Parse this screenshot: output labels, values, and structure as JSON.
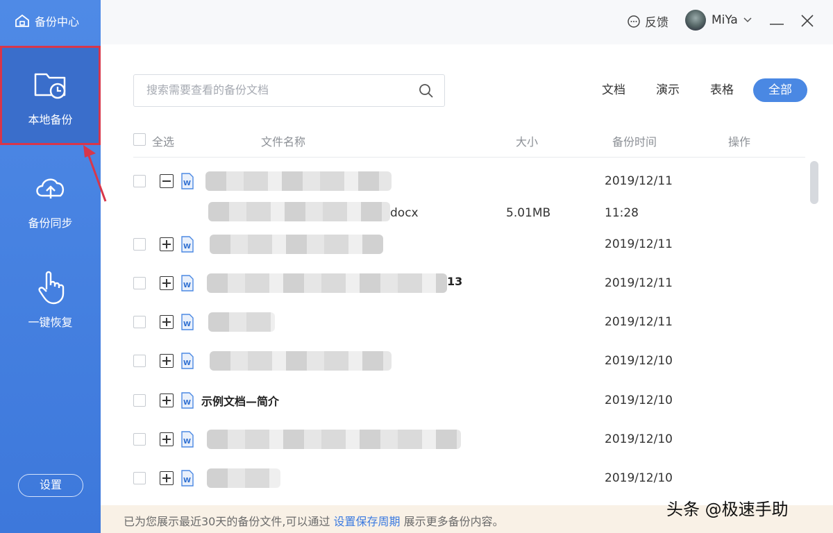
{
  "app": {
    "title": "备份中心"
  },
  "sidebar": {
    "items": [
      {
        "label": "本地备份",
        "icon": "folder-clock-icon"
      },
      {
        "label": "备份同步",
        "icon": "cloud-upload-icon"
      },
      {
        "label": "一键恢复",
        "icon": "hand-pointer-icon"
      }
    ],
    "settings_label": "设置"
  },
  "topbar": {
    "feedback_label": "反馈",
    "user_name": "MiYa"
  },
  "search": {
    "placeholder": "搜索需要查看的备份文档"
  },
  "filters": [
    "文档",
    "演示",
    "表格",
    "全部"
  ],
  "table": {
    "headers": {
      "select_all": "全选",
      "name": "文件名称",
      "size": "大小",
      "time": "备份时间",
      "action": "操作"
    },
    "rows": [
      {
        "expanded": true,
        "name": "",
        "date": "2019/12/11"
      },
      {
        "expanded": false,
        "name": "",
        "date": "2019/12/11"
      },
      {
        "expanded": false,
        "name": "13",
        "date": "2019/12/11"
      },
      {
        "expanded": false,
        "name": "",
        "date": "2019/12/11"
      },
      {
        "expanded": false,
        "name": "",
        "date": "2019/12/10"
      },
      {
        "expanded": false,
        "name": "示例文档—简介",
        "date": "2019/12/10"
      },
      {
        "expanded": false,
        "name": "",
        "date": "2019/12/10"
      },
      {
        "expanded": false,
        "name": "",
        "date": "2019/12/10"
      }
    ],
    "subrow": {
      "file_suffix": "docx",
      "size": "5.01MB",
      "time": "11:28"
    }
  },
  "footer": {
    "before": "已为您展示最近30天的备份文件,可以通过 ",
    "link": "设置保存周期",
    "after": " 展示更多备份内容。"
  },
  "watermark": "头条 @极速手助",
  "colors": {
    "sidebar": "#4f8ae6",
    "accent": "#4a88e3",
    "highlight_border": "#d8364a",
    "footer_bg": "#f9f1e6"
  }
}
